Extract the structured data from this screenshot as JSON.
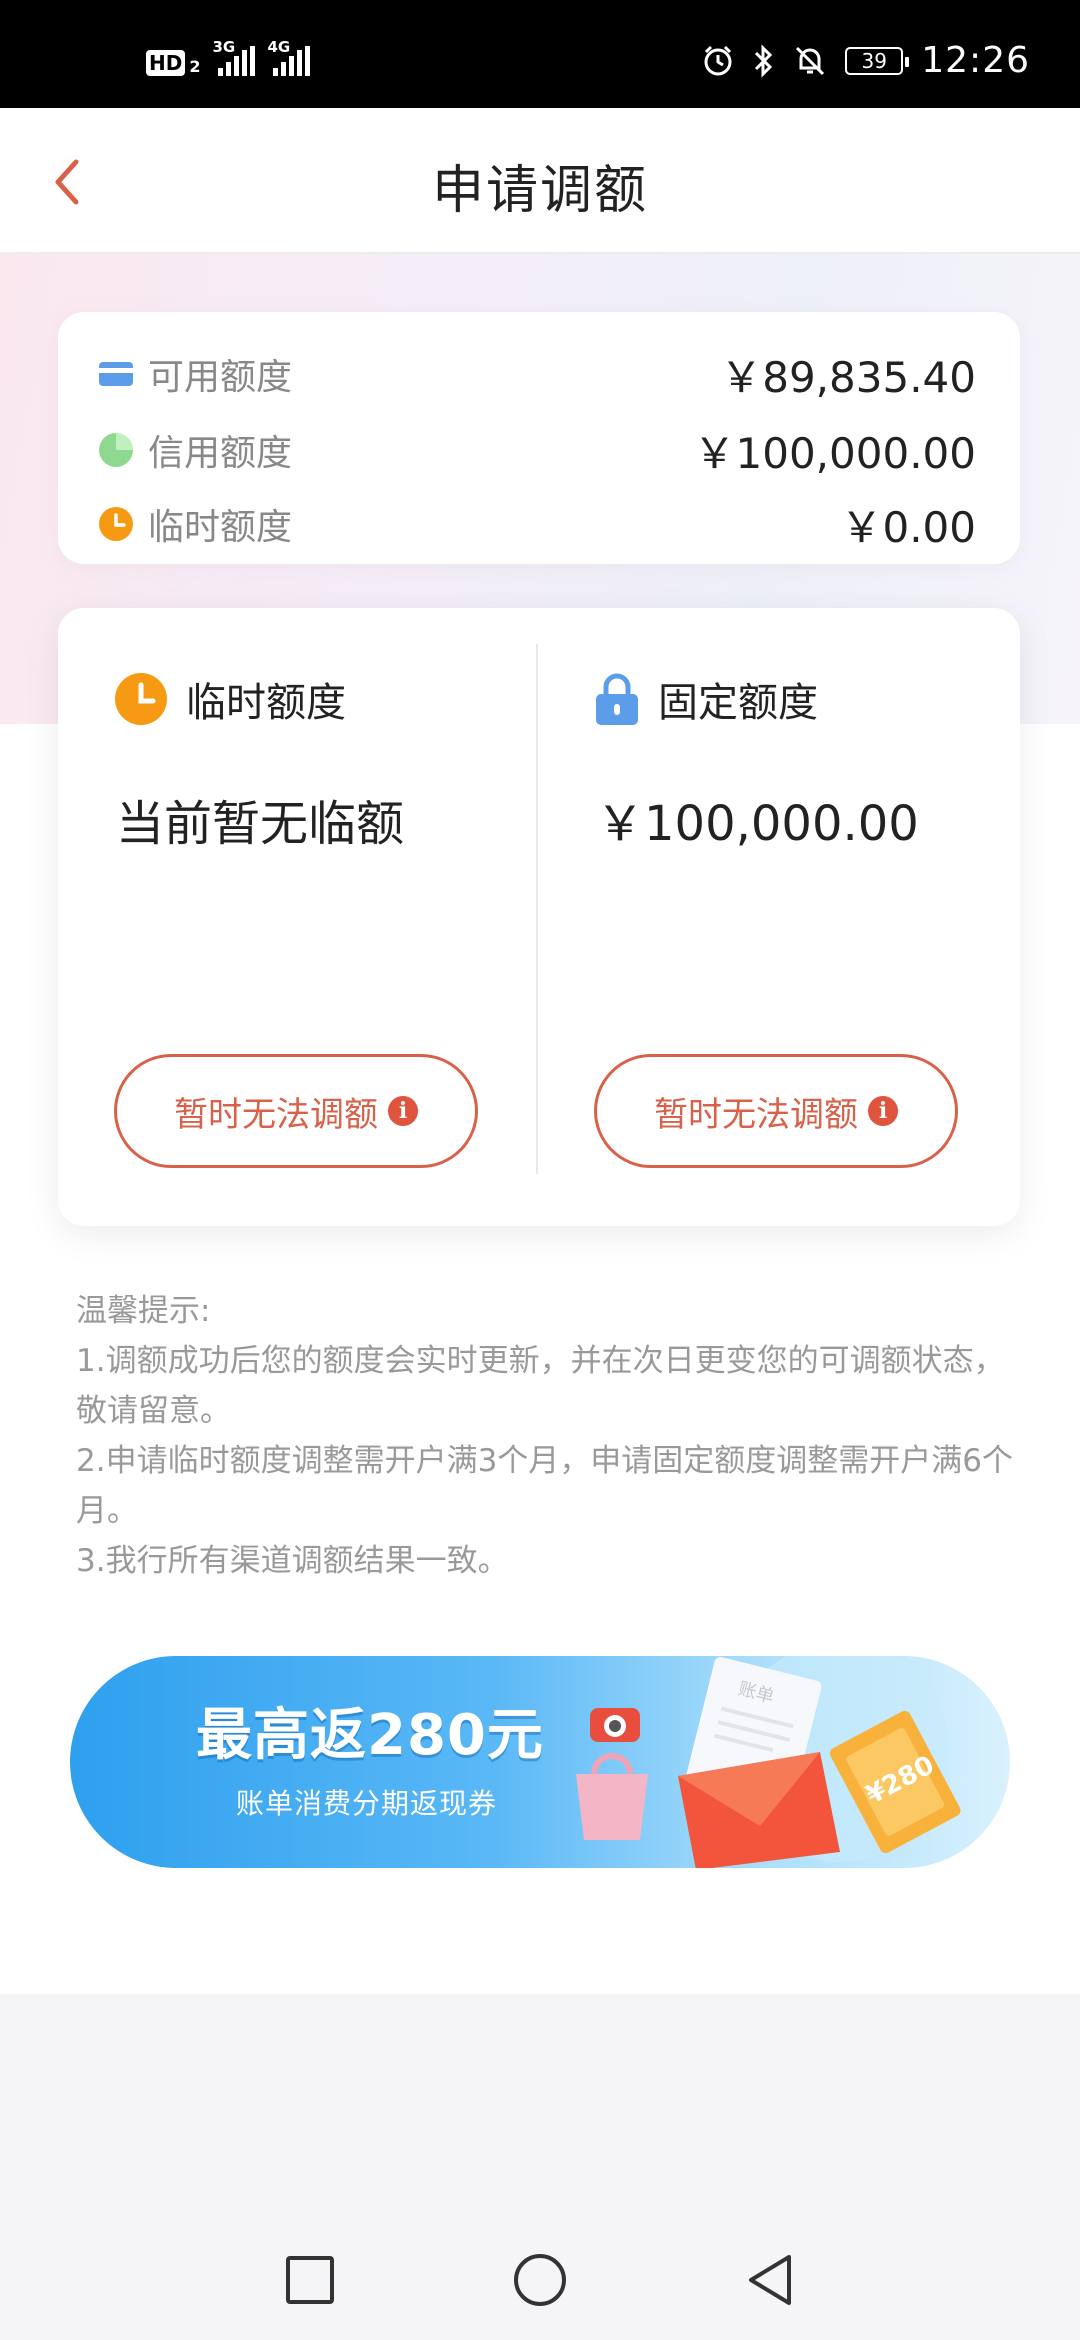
{
  "status_bar": {
    "hd_label": "HD",
    "hd_sub": "2",
    "signal1_label": "3G",
    "signal2_label": "4G",
    "battery": "39",
    "time": "12:26"
  },
  "header": {
    "title": "申请调额"
  },
  "summary": {
    "rows": [
      {
        "label": "可用额度",
        "value": "￥89,835.40",
        "icon": "card-icon"
      },
      {
        "label": "信用额度",
        "value": "￥100,000.00",
        "icon": "pie-icon"
      },
      {
        "label": "临时额度",
        "value": "￥0.00",
        "icon": "clock-icon"
      }
    ]
  },
  "limits": {
    "temporary": {
      "title": "临时额度",
      "value": "当前暂无临额",
      "button": "暂时无法调额"
    },
    "fixed": {
      "title": "固定额度",
      "value": "￥100,000.00",
      "button": "暂时无法调额"
    }
  },
  "tips": {
    "heading": "温馨提示:",
    "items": [
      "1.调额成功后您的额度会实时更新，并在次日更变您的可调额状态，敬请留意。",
      "2.申请临时额度调整需开户满3个月，申请固定额度调整需开户满6个月。",
      "3.我行所有渠道调额结果一致。"
    ]
  },
  "banner": {
    "headline": "最高返280元",
    "subline": "账单消费分期返现券",
    "envelope_text": "账单",
    "coupon_text": "¥280"
  },
  "colors": {
    "accent_red": "#d9614a",
    "orange": "#f59a12",
    "blue": "#5b9de8",
    "green": "#8fd88f"
  }
}
